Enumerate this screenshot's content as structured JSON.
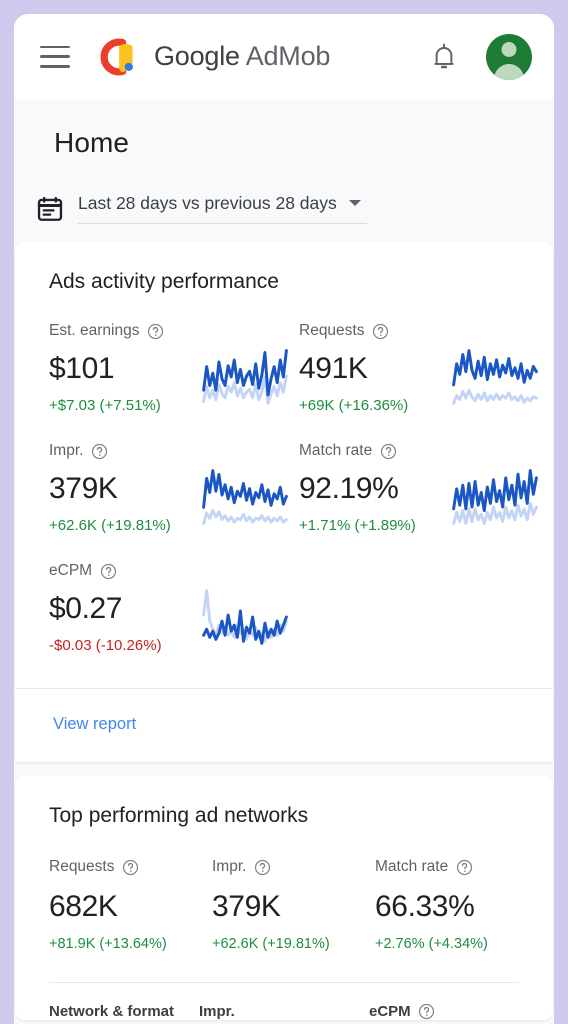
{
  "appbar": {
    "menu_icon": "hamburger-menu-icon",
    "logo_icon": "admob-logo-icon",
    "brand_primary": "Google",
    "brand_secondary": "AdMob",
    "notifications_icon": "bell-icon",
    "avatar_icon": "account-avatar"
  },
  "header": {
    "title": "Home",
    "calendar_icon": "calendar-icon",
    "date_range": "Last 28 days vs previous 28 days",
    "caret_icon": "chevron-down-icon"
  },
  "ads_activity": {
    "title": "Ads activity performance",
    "metrics": [
      {
        "label": "Est. earnings",
        "value": "$101",
        "delta": "+$7.03 (+7.51%)",
        "direction": "up"
      },
      {
        "label": "Requests",
        "value": "491K",
        "delta": "+69K (+16.36%)",
        "direction": "up"
      },
      {
        "label": "Impr.",
        "value": "379K",
        "delta": "+62.6K (+19.81%)",
        "direction": "up"
      },
      {
        "label": "Match rate",
        "value": "92.19%",
        "delta": "+1.71% (+1.89%)",
        "direction": "up"
      },
      {
        "label": "eCPM",
        "value": "$0.27",
        "delta": "-$0.03 (-10.26%)",
        "direction": "down"
      }
    ],
    "view_report_label": "View report"
  },
  "top_networks": {
    "title": "Top performing ad networks",
    "metrics": [
      {
        "label": "Requests",
        "value": "682K",
        "delta": "+81.9K (+13.64%)",
        "direction": "up"
      },
      {
        "label": "Impr.",
        "value": "379K",
        "delta": "+62.6K (+19.81%)",
        "direction": "up"
      },
      {
        "label": "Match rate",
        "value": "66.33%",
        "delta": "+2.76% (+4.34%)",
        "direction": "up"
      }
    ],
    "table_headers": [
      {
        "label": "Network & format",
        "has_help": false
      },
      {
        "label": "Impr.",
        "has_help": false
      },
      {
        "label": "eCPM",
        "has_help": true
      }
    ]
  },
  "colors": {
    "page_background": "#cfc9ee",
    "card_background": "#ffffff",
    "surface": "#f8f9fb",
    "positive": "#1e8e3e",
    "negative": "#c5221f",
    "link": "#4285f4",
    "sparkline_current": "#1a56c4",
    "sparkline_previous": "#c3d4f5",
    "avatar": "#1e7b35"
  },
  "chart_data": [
    {
      "type": "line",
      "title": "Est. earnings",
      "series": [
        {
          "name": "Last 28 days",
          "values": [
            30,
            55,
            35,
            48,
            30,
            60,
            42,
            35,
            56,
            44,
            62,
            38,
            52,
            35,
            45,
            50,
            36,
            58,
            32,
            46,
            70,
            25,
            42,
            55,
            38,
            62,
            44,
            72
          ]
        },
        {
          "name": "Previous 28 days",
          "values": [
            18,
            34,
            22,
            30,
            20,
            36,
            26,
            22,
            34,
            28,
            38,
            24,
            32,
            22,
            28,
            31,
            22,
            36,
            20,
            28,
            44,
            16,
            26,
            34,
            24,
            38,
            28,
            45
          ]
        }
      ]
    },
    {
      "type": "line",
      "title": "Requests",
      "series": [
        {
          "name": "Last 28 days",
          "values": [
            40,
            72,
            56,
            86,
            60,
            92,
            62,
            50,
            76,
            54,
            82,
            48,
            72,
            56,
            78,
            52,
            70,
            58,
            80,
            54,
            66,
            50,
            72,
            44,
            62,
            50,
            68,
            60
          ]
        },
        {
          "name": "Previous 28 days",
          "values": [
            12,
            24,
            18,
            30,
            20,
            32,
            22,
            16,
            26,
            18,
            28,
            16,
            24,
            18,
            26,
            18,
            24,
            20,
            28,
            18,
            22,
            16,
            24,
            14,
            20,
            16,
            22,
            20
          ]
        }
      ]
    },
    {
      "type": "line",
      "title": "Impr.",
      "series": [
        {
          "name": "Last 28 days",
          "values": [
            35,
            80,
            58,
            92,
            60,
            86,
            54,
            70,
            48,
            66,
            42,
            60,
            52,
            72,
            46,
            64,
            40,
            58,
            50,
            70,
            44,
            62,
            38,
            56,
            48,
            66,
            40,
            52
          ]
        },
        {
          "name": "Previous 28 days",
          "values": [
            10,
            26,
            18,
            30,
            20,
            28,
            16,
            22,
            14,
            20,
            12,
            18,
            16,
            24,
            14,
            20,
            12,
            18,
            16,
            22,
            14,
            20,
            12,
            18,
            14,
            20,
            12,
            16
          ]
        }
      ]
    },
    {
      "type": "line",
      "title": "Match rate",
      "series": [
        {
          "name": "Last 28 days",
          "values": [
            30,
            52,
            34,
            56,
            30,
            58,
            32,
            60,
            34,
            48,
            28,
            54,
            36,
            62,
            38,
            50,
            32,
            64,
            40,
            56,
            34,
            68,
            42,
            60,
            36,
            72,
            46,
            64
          ]
        },
        {
          "name": "Previous 28 days",
          "values": [
            14,
            26,
            16,
            28,
            14,
            30,
            16,
            30,
            18,
            24,
            14,
            26,
            18,
            32,
            20,
            26,
            16,
            32,
            20,
            28,
            18,
            34,
            22,
            30,
            18,
            36,
            24,
            32
          ]
        }
      ]
    },
    {
      "type": "line",
      "title": "eCPM",
      "series": [
        {
          "name": "Last 28 days",
          "values": [
            26,
            32,
            24,
            30,
            22,
            28,
            40,
            26,
            46,
            30,
            36,
            24,
            50,
            20,
            34,
            28,
            44,
            22,
            30,
            18,
            38,
            24,
            32,
            26,
            40,
            28,
            36,
            44
          ]
        },
        {
          "name": "Previous 28 days",
          "values": [
            46,
            70,
            40,
            32,
            26,
            36,
            28,
            34,
            26,
            30,
            24,
            36,
            28,
            32,
            22,
            30,
            26,
            34,
            24,
            28,
            20,
            30,
            24,
            32,
            26,
            36,
            30,
            40
          ]
        }
      ]
    }
  ]
}
